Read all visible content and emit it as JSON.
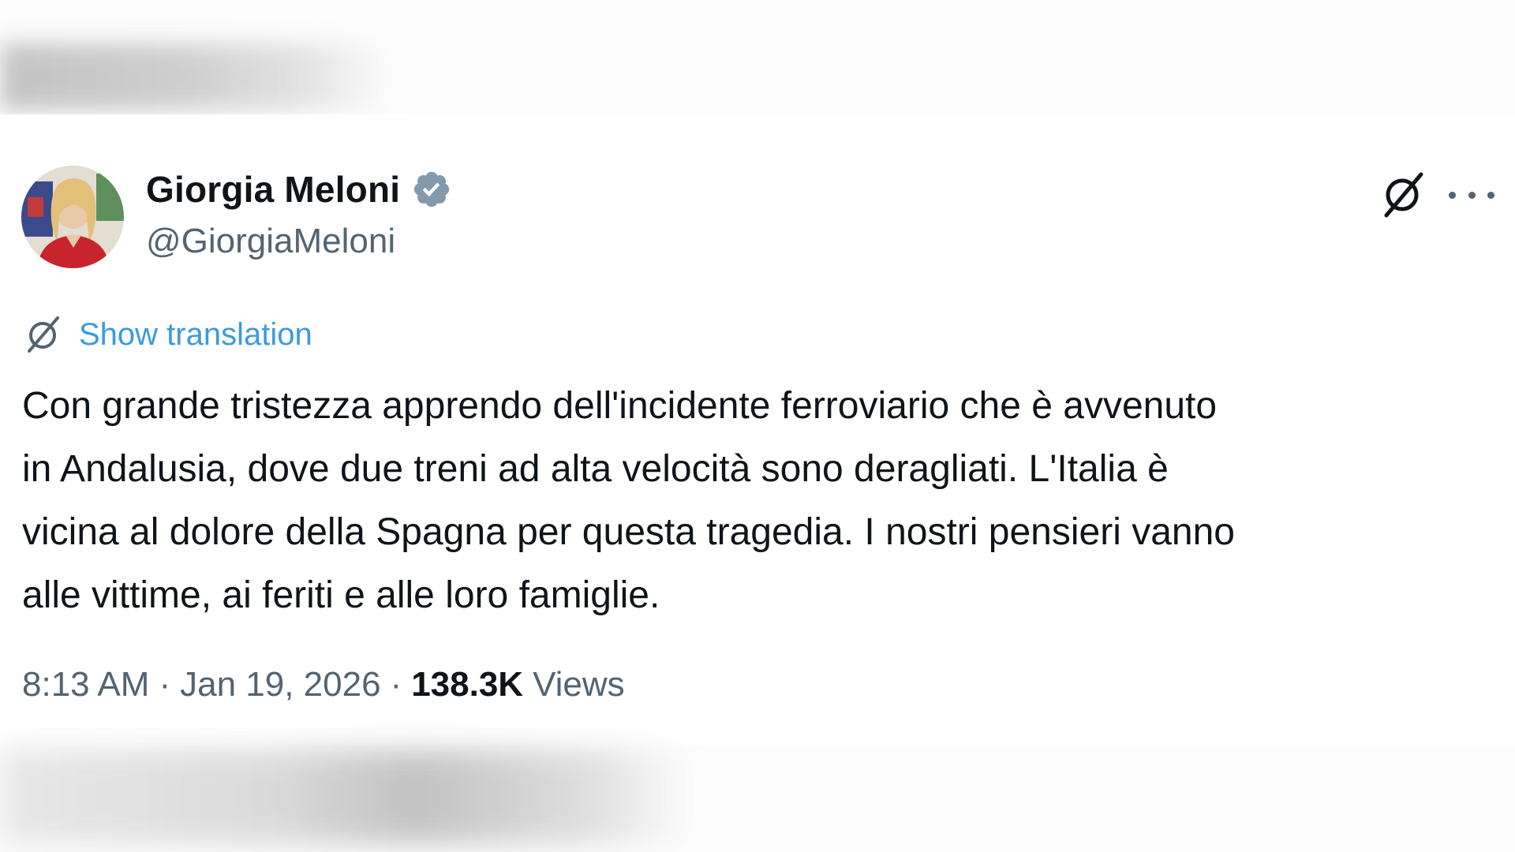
{
  "tweet": {
    "author": {
      "display_name": "Giorgia Meloni",
      "handle": "@GiorgiaMeloni",
      "verified": true,
      "verified_color": "#829aab"
    },
    "show_translation_label": "Show translation",
    "text": "Con grande tristezza apprendo dell'incidente ferroviario che è avvenuto\nin Andalusia, dove due treni ad alta velocità sono deragliati. L'Italia è\nvicina al dolore della Spagna per questa tragedia. I nostri pensieri vanno\nalle vittime, ai feriti e alle loro famiglie.",
    "meta": {
      "time": "8:13 AM",
      "separator": "·",
      "date": "Jan 19, 2026",
      "views_count": "138.3K",
      "views_label": "Views"
    }
  },
  "icons": {
    "grok": "grok-icon",
    "more": "more-icon",
    "translation": "grok-translate-icon",
    "verified": "verified-badge-icon"
  },
  "colors": {
    "link": "#3b9ae0",
    "text_primary": "#0f1419",
    "text_secondary": "#536471"
  }
}
